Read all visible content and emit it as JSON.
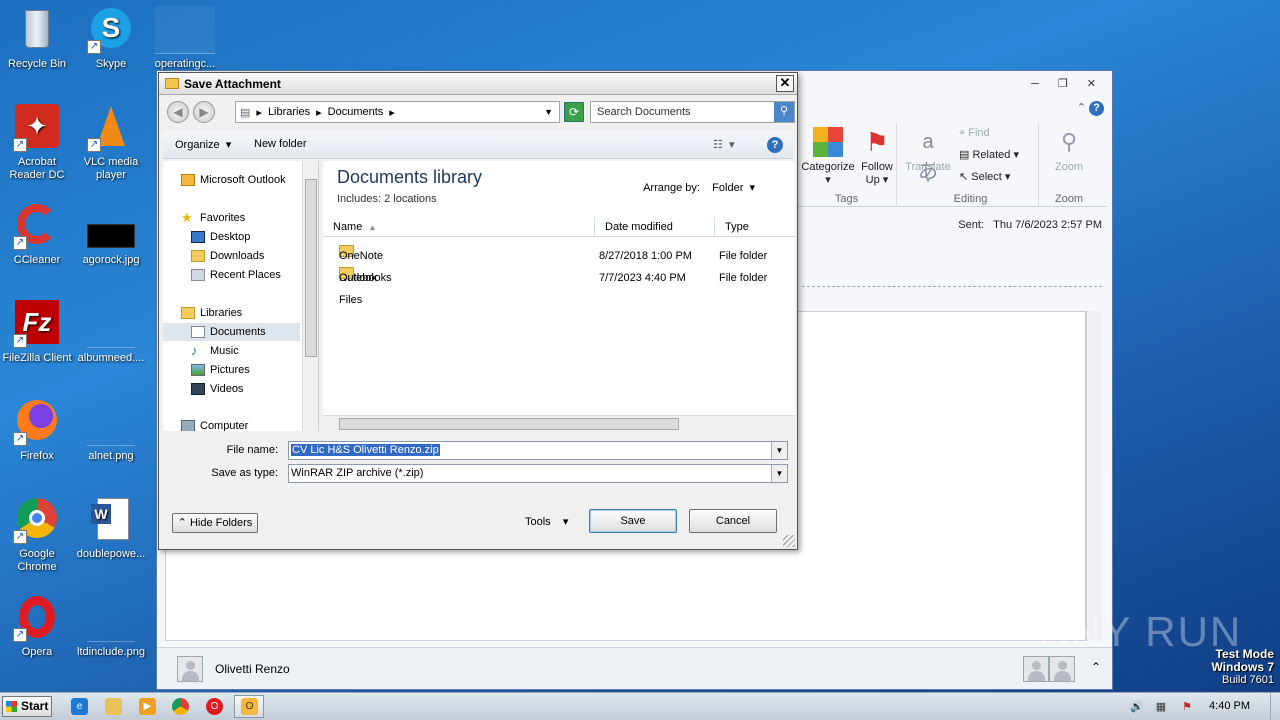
{
  "desktop": {
    "icons": [
      {
        "label": "Recycle Bin",
        "icon": "recycle-bin-icon"
      },
      {
        "label": "Skype",
        "icon": "skype-icon"
      },
      {
        "label": "operatingc...",
        "icon": "file-icon"
      },
      {
        "label": "Acrobat Reader DC",
        "icon": "acrobat-icon"
      },
      {
        "label": "VLC media player",
        "icon": "vlc-icon"
      },
      {
        "label": "CCleaner",
        "icon": "ccleaner-icon"
      },
      {
        "label": "agorock.jpg",
        "icon": "image-icon"
      },
      {
        "label": "FileZilla Client",
        "icon": "filezilla-icon"
      },
      {
        "label": "albumneed....",
        "icon": "file-icon"
      },
      {
        "label": "Firefox",
        "icon": "firefox-icon"
      },
      {
        "label": "alnet.png",
        "icon": "image-icon"
      },
      {
        "label": "Google Chrome",
        "icon": "chrome-icon"
      },
      {
        "label": "doublepowe...",
        "icon": "word-doc-icon"
      },
      {
        "label": "Opera",
        "icon": "opera-icon"
      },
      {
        "label": "ltdinclude.png",
        "icon": "image-icon"
      }
    ]
  },
  "outlook": {
    "ribbon": {
      "categorize": "Categorize",
      "follow_up_1": "Follow",
      "follow_up_2": "Up",
      "translate": "Translate",
      "find": "Find",
      "related": "Related",
      "select": "Select",
      "zoom": "Zoom",
      "group_tags": "Tags",
      "group_editing": "Editing",
      "group_zoom": "Zoom"
    },
    "sent_label": "Sent:",
    "sent_value": "Thu 7/6/2023 2:57 PM",
    "sender": "Olivetti Renzo"
  },
  "dialog": {
    "title": "Save Attachment",
    "close": "✕",
    "breadcrumb": [
      "Libraries",
      "Documents"
    ],
    "search_placeholder": "Search Documents",
    "organize": "Organize",
    "new_folder": "New folder",
    "nav_items": [
      {
        "label": "Microsoft Outlook"
      },
      {
        "label": "Favorites"
      },
      {
        "label": "Desktop"
      },
      {
        "label": "Downloads"
      },
      {
        "label": "Recent Places"
      },
      {
        "label": "Libraries"
      },
      {
        "label": "Documents"
      },
      {
        "label": "Music"
      },
      {
        "label": "Pictures"
      },
      {
        "label": "Videos"
      },
      {
        "label": "Computer"
      }
    ],
    "library_title": "Documents library",
    "library_sub": "Includes:  2 locations",
    "arrange_by_label": "Arrange by:",
    "arrange_by_value": "Folder",
    "columns": [
      "Name",
      "Date modified",
      "Type"
    ],
    "files": [
      {
        "name": "OneNote Notebooks",
        "date": "8/27/2018 1:00 PM",
        "type": "File folder"
      },
      {
        "name": "Outlook Files",
        "date": "7/7/2023 4:40 PM",
        "type": "File folder"
      }
    ],
    "file_name_label": "File name:",
    "file_name_value": "CV Lic H&S Olivetti Renzo.zip",
    "save_type_label": "Save as type:",
    "save_type_value": "WinRAR ZIP archive (*.zip)",
    "hide_folders": "Hide Folders",
    "tools": "Tools",
    "save": "Save",
    "cancel": "Cancel"
  },
  "taskbar": {
    "start": "Start",
    "clock": "4:40 PM"
  },
  "watermark": "ANY RUN",
  "test_mode": {
    "line1": "Test Mode",
    "line2": "Windows 7",
    "line3": "Build 7601"
  }
}
